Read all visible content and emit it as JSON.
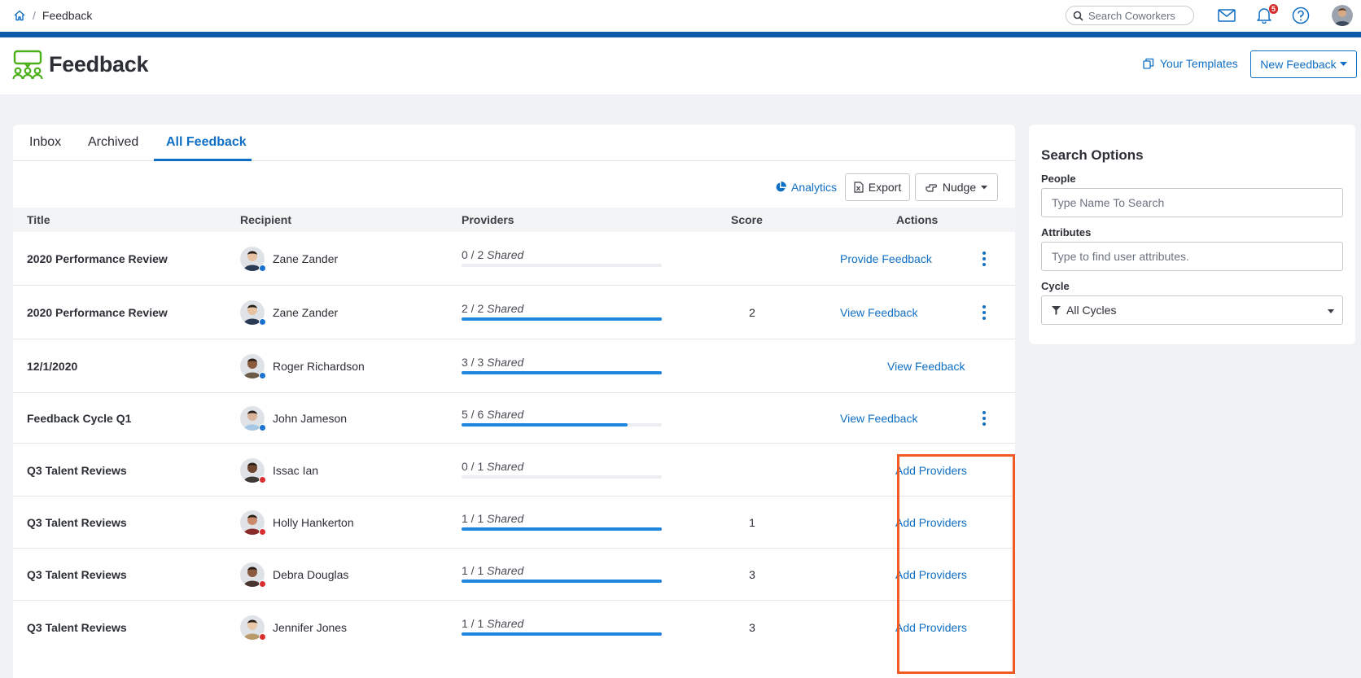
{
  "topbar": {
    "breadcrumb_sep": "/",
    "breadcrumb_current": "Feedback",
    "search_placeholder": "Search Coworkers",
    "notification_count": "5"
  },
  "header": {
    "title": "Feedback",
    "templates_label": "Your Templates",
    "new_feedback_label": "New Feedback"
  },
  "tabs": [
    {
      "label": "Inbox"
    },
    {
      "label": "Archived"
    },
    {
      "label": "All Feedback",
      "active": true
    }
  ],
  "toolbar": {
    "analytics_label": "Analytics",
    "export_label": "Export",
    "nudge_label": "Nudge"
  },
  "table": {
    "columns": [
      "Title",
      "Recipient",
      "Providers",
      "Score",
      "Actions"
    ],
    "rows": [
      {
        "title": "2020 Performance Review",
        "recipient": "Zane Zander",
        "providers_count": "0 / 2",
        "providers_word": "Shared",
        "progress": 0,
        "score": "",
        "action": "Provide Feedback",
        "menu": true,
        "status": "blue"
      },
      {
        "title": "2020 Performance Review",
        "recipient": "Zane Zander",
        "providers_count": "2 / 2",
        "providers_word": "Shared",
        "progress": 1,
        "score": "2",
        "action": "View Feedback",
        "menu": true,
        "status": "blue"
      },
      {
        "title": "12/1/2020",
        "recipient": "Roger Richardson",
        "providers_count": "3 / 3",
        "providers_word": "Shared",
        "progress": 1,
        "score": "",
        "action": "View Feedback",
        "menu": false,
        "status": "blue"
      },
      {
        "title": "Feedback Cycle Q1",
        "recipient": "John Jameson",
        "providers_count": "5 / 6",
        "providers_word": "Shared",
        "progress": 0.83,
        "score": "",
        "action": "View Feedback",
        "menu": true,
        "status": "blue"
      },
      {
        "title": "Q3 Talent Reviews",
        "recipient": "Issac Ian",
        "providers_count": "0 / 1",
        "providers_word": "Shared",
        "progress": 0,
        "score": "",
        "action": "Add Providers",
        "menu": false,
        "status": "red"
      },
      {
        "title": "Q3 Talent Reviews",
        "recipient": "Holly Hankerton",
        "providers_count": "1 / 1",
        "providers_word": "Shared",
        "progress": 1,
        "score": "1",
        "action": "Add Providers",
        "menu": false,
        "status": "red"
      },
      {
        "title": "Q3 Talent Reviews",
        "recipient": "Debra Douglas",
        "providers_count": "1 / 1",
        "providers_word": "Shared",
        "progress": 1,
        "score": "3",
        "action": "Add Providers",
        "menu": false,
        "status": "red"
      },
      {
        "title": "Q3 Talent Reviews",
        "recipient": "Jennifer Jones",
        "providers_count": "1 / 1",
        "providers_word": "Shared",
        "progress": 1,
        "score": "3",
        "action": "Add Providers",
        "menu": false,
        "status": "red"
      }
    ]
  },
  "search_options": {
    "title": "Search Options",
    "people_label": "People",
    "people_placeholder": "Type Name To Search",
    "attributes_label": "Attributes",
    "attributes_placeholder": "Type to find user attributes.",
    "cycle_label": "Cycle",
    "cycle_value": "All Cycles"
  },
  "colors": {
    "accent": "#0f6fc4",
    "brand_bar": "#0f5aa8",
    "progress": "#1f86e0",
    "status_blue": "#1a73d1",
    "status_red": "#d9302f",
    "highlight": "#f05a24"
  }
}
